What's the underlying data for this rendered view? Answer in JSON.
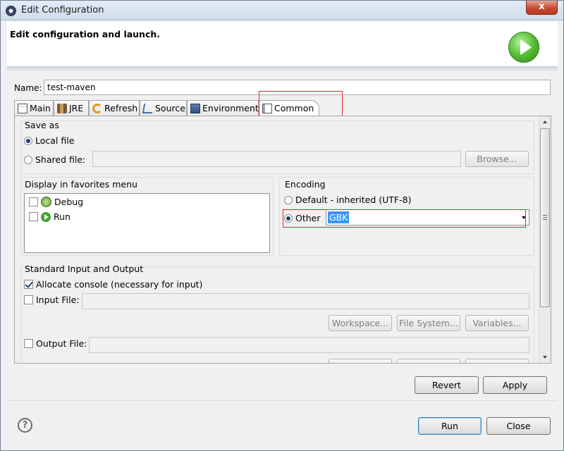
{
  "window": {
    "title": "Edit Configuration",
    "close_label": "x"
  },
  "banner": {
    "title": "Edit configuration and launch."
  },
  "name_field": {
    "label": "Name:",
    "value": "test-maven"
  },
  "tabs": [
    {
      "label": "Main",
      "icon": "main-tab-icon"
    },
    {
      "label": "JRE",
      "icon": "jre-icon"
    },
    {
      "label": "Refresh",
      "icon": "refresh-icon"
    },
    {
      "label": "Source",
      "icon": "source-icon"
    },
    {
      "label": "Environment",
      "icon": "environment-icon"
    },
    {
      "label": "Common",
      "icon": "common-tab-icon",
      "active": true
    }
  ],
  "save_as": {
    "title": "Save as",
    "local_file_label": "Local file",
    "shared_file_label": "Shared file:",
    "selected": "local_file",
    "browse_label": "Browse..."
  },
  "favorites": {
    "title": "Display in favorites menu",
    "items": [
      {
        "label": "Debug",
        "checked": false,
        "icon": "debug-icon"
      },
      {
        "label": "Run",
        "checked": false,
        "icon": "run-icon"
      }
    ]
  },
  "encoding": {
    "title": "Encoding",
    "default_label": "Default - inherited (UTF-8)",
    "other_label": "Other",
    "selected": "other",
    "other_value": "GBK"
  },
  "std_io": {
    "title": "Standard Input and Output",
    "allocate_console_label": "Allocate console (necessary for input)",
    "allocate_console_checked": true,
    "input_file_label": "Input File:",
    "input_file_checked": false,
    "output_file_label": "Output File:",
    "output_file_checked": false,
    "workspace_label": "Workspace...",
    "file_system_label": "File System...",
    "variables_label": "Variables..."
  },
  "actions": {
    "revert_label": "Revert",
    "apply_label": "Apply",
    "run_label": "Run",
    "close_label": "Close",
    "help_label": "?"
  },
  "colors": {
    "highlight_box": "#e3262b",
    "selection": "#3399ff"
  }
}
